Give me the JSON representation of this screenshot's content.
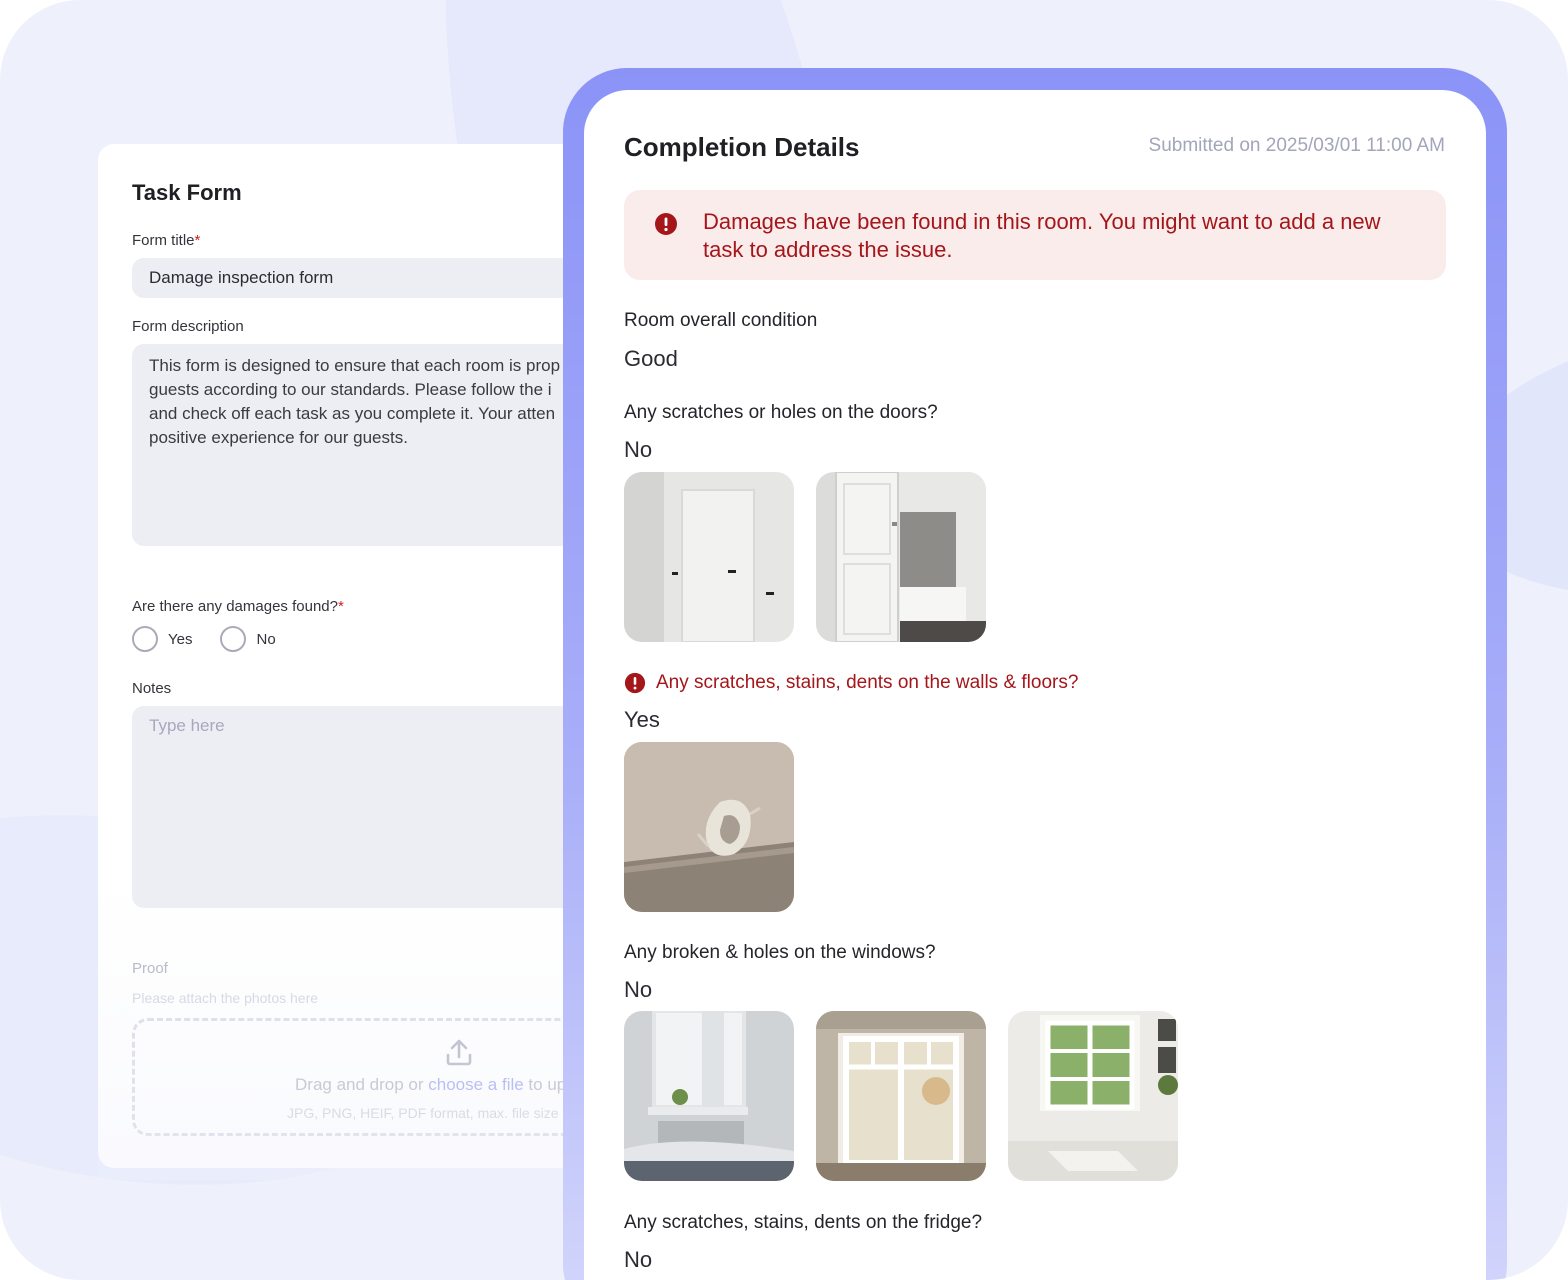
{
  "task_form": {
    "title": "Task Form",
    "form_title_label": "Form title",
    "required_mark": "*",
    "form_title_value": "Damage inspection form",
    "form_description_label": "Form description",
    "form_description_value": "This form is designed to ensure that each room is prop\nguests according to our standards. Please follow the i\nand check off each task as you complete it. Your atten\npositive experience for our guests.",
    "damages_label": "Are there any damages found?",
    "options": [
      "Yes",
      "No"
    ],
    "notes_label": "Notes",
    "notes_placeholder": "Type here",
    "proof_label": "Proof",
    "proof_hint": "Please attach the photos here",
    "drop_text_before": "Drag and drop or ",
    "drop_link": "choose a file",
    "drop_text_after": " to up",
    "drop_formats": "JPG, PNG, HEIF, PDF format, max. file size o"
  },
  "completion": {
    "title": "Completion Details",
    "submitted": "Submitted on 2025/03/01 11:00 AM",
    "alert": "Damages have been found in this room. You might want to add a new task to address the issue.",
    "items": [
      {
        "question": "Room overall condition",
        "answer": "Good"
      },
      {
        "question": "Any scratches or holes on the doors?",
        "answer": "No"
      },
      {
        "question": "Any scratches, stains, dents on the walls & floors?",
        "answer": "Yes"
      },
      {
        "question": "Any broken & holes on the windows?",
        "answer": "No"
      },
      {
        "question": "Any scratches, stains, dents on the fridge?",
        "answer": "No"
      }
    ]
  },
  "colors": {
    "accent": "#8b93f7",
    "alert_bg": "#fbecec",
    "alert_text": "#a5161b",
    "link": "#a9b0f2"
  }
}
